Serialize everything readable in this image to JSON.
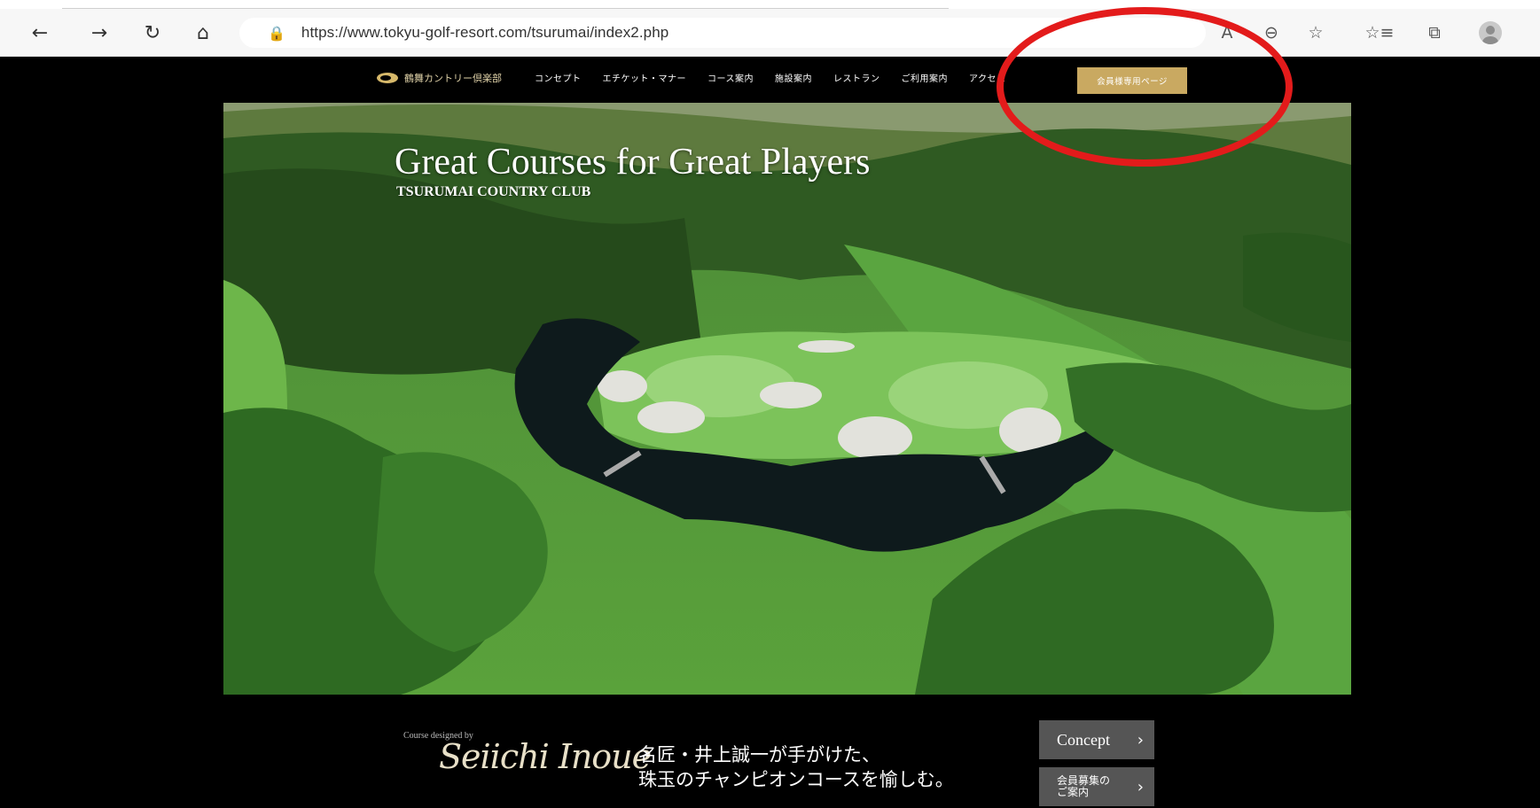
{
  "browser": {
    "back_icon": "←",
    "forward_icon": "→",
    "reload_icon": "↻",
    "home_icon": "⌂",
    "lock_icon": "🔒",
    "url": "https://www.tokyu-golf-resort.com/tsurumai/index2.php",
    "read_aloud_icon": "A",
    "zoom_icon": "⊖",
    "favorite_add_icon": "☆",
    "favorites_icon": "☆≡",
    "collections_icon": "⧉"
  },
  "header": {
    "logo_text": "鶴舞カントリー倶楽部",
    "menu": [
      "コンセプト",
      "エチケット・マナー",
      "コース案内",
      "施設案内",
      "レストラン",
      "ご利用案内",
      "アクセス"
    ],
    "member_button": "会員様専用ページ"
  },
  "hero": {
    "title": "Great Courses for Great Players",
    "subtitle": "TSURUMAI COUNTRY CLUB"
  },
  "bottom": {
    "designed_by": "Course designed by",
    "signature": "Seiichi Inoue",
    "tagline_line1": "名匠・井上誠一が手がけた、",
    "tagline_line2": "珠玉のチャンピオンコースを愉しむ。",
    "concept_button": "Concept",
    "recruit_button": "会員募集の\nご案内",
    "chevron": "›"
  },
  "colors": {
    "member_button_bg": "#c9a961",
    "highlight": "#e31b1b",
    "side_button_bg": "#555555"
  }
}
